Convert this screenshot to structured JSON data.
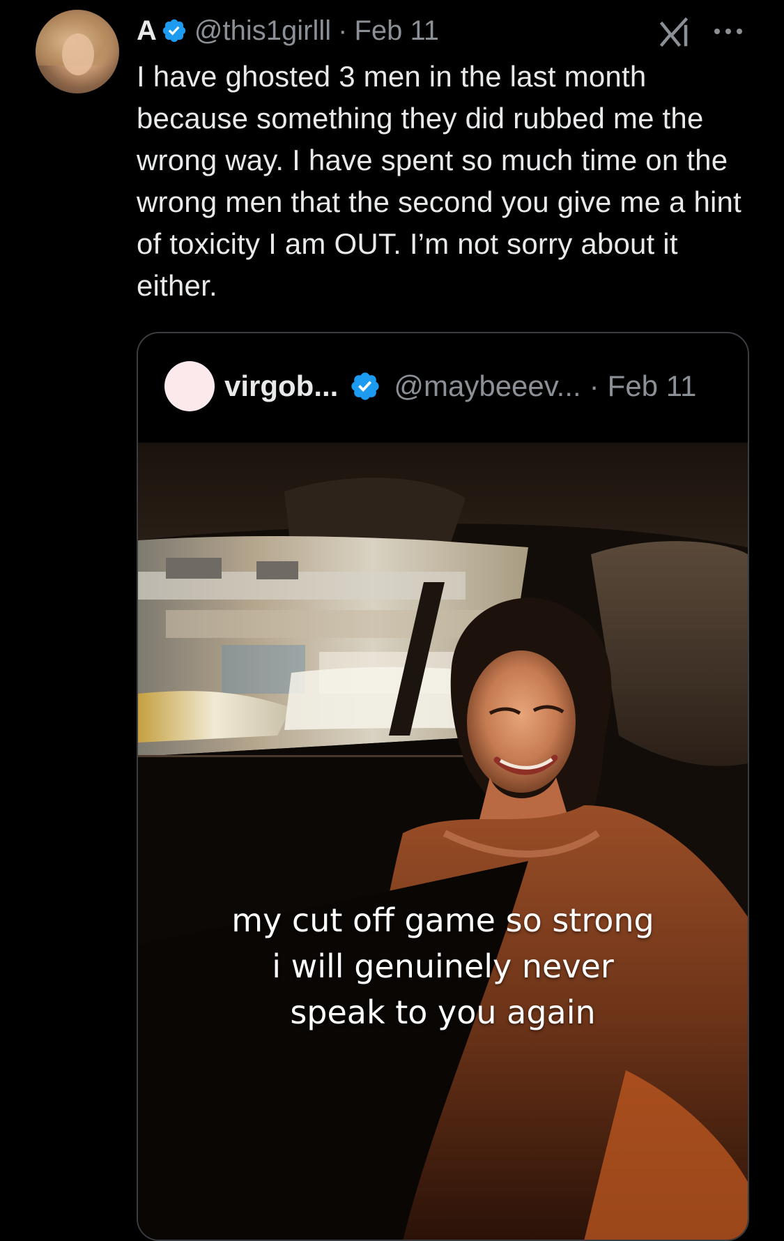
{
  "tweet": {
    "display_name": "A",
    "handle": "@this1girlll",
    "separator": "·",
    "date": "Feb 11",
    "verified_icon": "verified-badge-icon",
    "grok_icon": "grok-icon",
    "more_icon": "more-options-icon",
    "text": "I have ghosted 3 men in the last month because something they did rubbed me the wrong way. I have spent so much time on the wrong men that the second you give me a hint of toxicity I am OUT. I’m not sorry about it either."
  },
  "quote": {
    "display_name": "virgob...",
    "handle": "@maybeeev...",
    "separator": "·",
    "date": "Feb 11",
    "verified_icon": "verified-badge-icon",
    "media": {
      "caption_lines": [
        "my cut off game so strong",
        "i will genuinely never",
        "speak to you again"
      ]
    }
  },
  "colors": {
    "background": "#000000",
    "text_primary": "#e7e9ea",
    "text_secondary": "#8b9096",
    "verified_blue": "#1d9bf0",
    "card_border": "#3a3d42"
  }
}
